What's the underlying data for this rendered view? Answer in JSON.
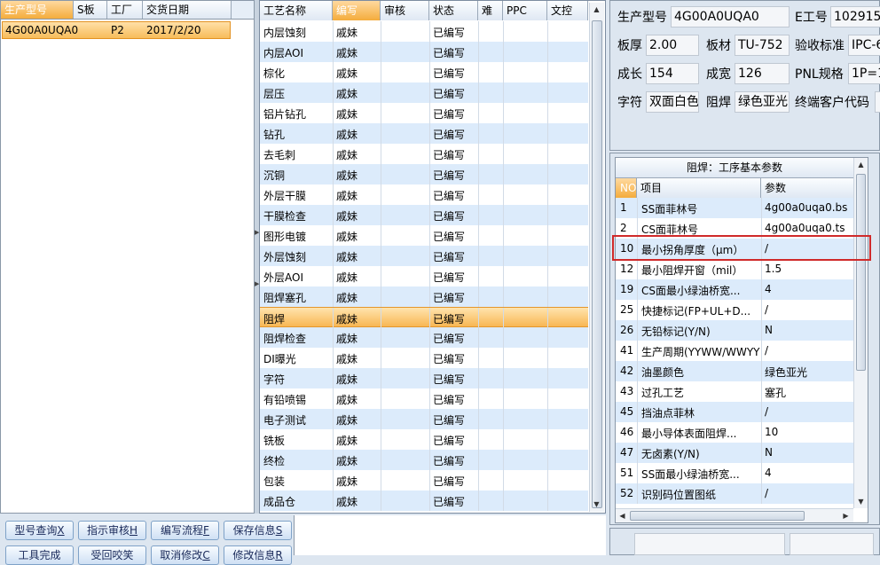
{
  "left_grid": {
    "columns": [
      "生产型号",
      "S板",
      "工厂",
      "交货日期"
    ],
    "rows": [
      {
        "model": "4G00A0UQA0",
        "sboard": "",
        "factory": "P2",
        "date": "2017/2/20"
      }
    ]
  },
  "process_grid": {
    "columns": [
      "工艺名称",
      "编写",
      "审核",
      "状态",
      "难",
      "PPC",
      "文控"
    ],
    "rows": [
      {
        "name": "内层蚀刻",
        "writer": "戚妹",
        "status": "已编写"
      },
      {
        "name": "内层AOI",
        "writer": "戚妹",
        "status": "已编写"
      },
      {
        "name": "棕化",
        "writer": "戚妹",
        "status": "已编写"
      },
      {
        "name": "层压",
        "writer": "戚妹",
        "status": "已编写"
      },
      {
        "name": "铝片钻孔",
        "writer": "戚妹",
        "status": "已编写"
      },
      {
        "name": "钻孔",
        "writer": "戚妹",
        "status": "已编写"
      },
      {
        "name": "去毛刺",
        "writer": "戚妹",
        "status": "已编写"
      },
      {
        "name": "沉铜",
        "writer": "戚妹",
        "status": "已编写"
      },
      {
        "name": "外层干膜",
        "writer": "戚妹",
        "status": "已编写"
      },
      {
        "name": "干膜检查",
        "writer": "戚妹",
        "status": "已编写"
      },
      {
        "name": "图形电镀",
        "writer": "戚妹",
        "status": "已编写"
      },
      {
        "name": "外层蚀刻",
        "writer": "戚妹",
        "status": "已编写"
      },
      {
        "name": "外层AOI",
        "writer": "戚妹",
        "status": "已编写"
      },
      {
        "name": "阻焊塞孔",
        "writer": "戚妹",
        "status": "已编写"
      },
      {
        "name": "阻焊",
        "writer": "戚妹",
        "status": "已编写"
      },
      {
        "name": "阻焊检查",
        "writer": "戚妹",
        "status": "已编写"
      },
      {
        "name": "DI曝光",
        "writer": "戚妹",
        "status": "已编写"
      },
      {
        "name": "字符",
        "writer": "戚妹",
        "status": "已编写"
      },
      {
        "name": "有铅喷锡",
        "writer": "戚妹",
        "status": "已编写"
      },
      {
        "name": "电子测试",
        "writer": "戚妹",
        "status": "已编写"
      },
      {
        "name": "铣板",
        "writer": "戚妹",
        "status": "已编写"
      },
      {
        "name": "终检",
        "writer": "戚妹",
        "status": "已编写"
      },
      {
        "name": "包装",
        "writer": "戚妹",
        "status": "已编写"
      },
      {
        "name": "成品仓",
        "writer": "戚妹",
        "status": "已编写"
      }
    ]
  },
  "info": {
    "model_label": "生产型号",
    "model_value": "4G00A0UQA0",
    "eng_label": "E工号",
    "eng_value": "102915",
    "thick_label": "板厚",
    "thick_value": "2.00",
    "material_label": "板材",
    "material_value": "TU-752",
    "standard_label": "验收标准",
    "standard_value": "IPC-6",
    "length_label": "成长",
    "length_value": "154",
    "width_label": "成宽",
    "width_value": "126",
    "pnl_label": "PNL规格",
    "pnl_value": "1P=1",
    "char_label": "字符",
    "char_value": "双面白色",
    "mask_label": "阻焊",
    "mask_value": "绿色亚光",
    "customer_label": "终端客户代码",
    "customer_value": ""
  },
  "params": {
    "title": "阻焊：工序基本参数",
    "columns": [
      "NO",
      "项目",
      "参数"
    ],
    "rows": [
      {
        "no": "1",
        "item": "SS面菲林号",
        "value": "4g00a0uqa0.bs"
      },
      {
        "no": "2",
        "item": "CS面菲林号",
        "value": "4g00a0uqa0.ts"
      },
      {
        "no": "10",
        "item": "最小拐角厚度（μm）",
        "value": "/"
      },
      {
        "no": "12",
        "item": "最小阻焊开窗（mil）",
        "value": "1.5"
      },
      {
        "no": "19",
        "item": "CS面最小绿油桥宽...",
        "value": "4"
      },
      {
        "no": "25",
        "item": "快捷标记(FP+UL+D...",
        "value": "/"
      },
      {
        "no": "26",
        "item": "无铅标记(Y/N)",
        "value": "N"
      },
      {
        "no": "41",
        "item": "生产周期(YYWW/WWYY)",
        "value": "/"
      },
      {
        "no": "42",
        "item": "油墨颜色",
        "value": "绿色亚光"
      },
      {
        "no": "43",
        "item": "过孔工艺",
        "value": "塞孔"
      },
      {
        "no": "45",
        "item": "挡油点菲林",
        "value": "/"
      },
      {
        "no": "46",
        "item": "最小导体表面阻焊...",
        "value": "10"
      },
      {
        "no": "47",
        "item": "无卤素(Y/N)",
        "value": "N"
      },
      {
        "no": "51",
        "item": "SS面最小绿油桥宽...",
        "value": "4"
      },
      {
        "no": "52",
        "item": "识别码位置图纸",
        "value": "/"
      }
    ]
  },
  "buttons": {
    "row1": [
      {
        "label": "型号查询",
        "key": "X"
      },
      {
        "label": "指示审核",
        "key": "H"
      },
      {
        "label": "编写流程",
        "key": "F"
      },
      {
        "label": "保存信息",
        "key": "S"
      }
    ],
    "row2": [
      {
        "label": "工具完成",
        "key": ""
      },
      {
        "label": "受回咬笑",
        "key": ""
      },
      {
        "label": "取消修改",
        "key": "C"
      },
      {
        "label": "修改信息",
        "key": "R"
      }
    ]
  }
}
